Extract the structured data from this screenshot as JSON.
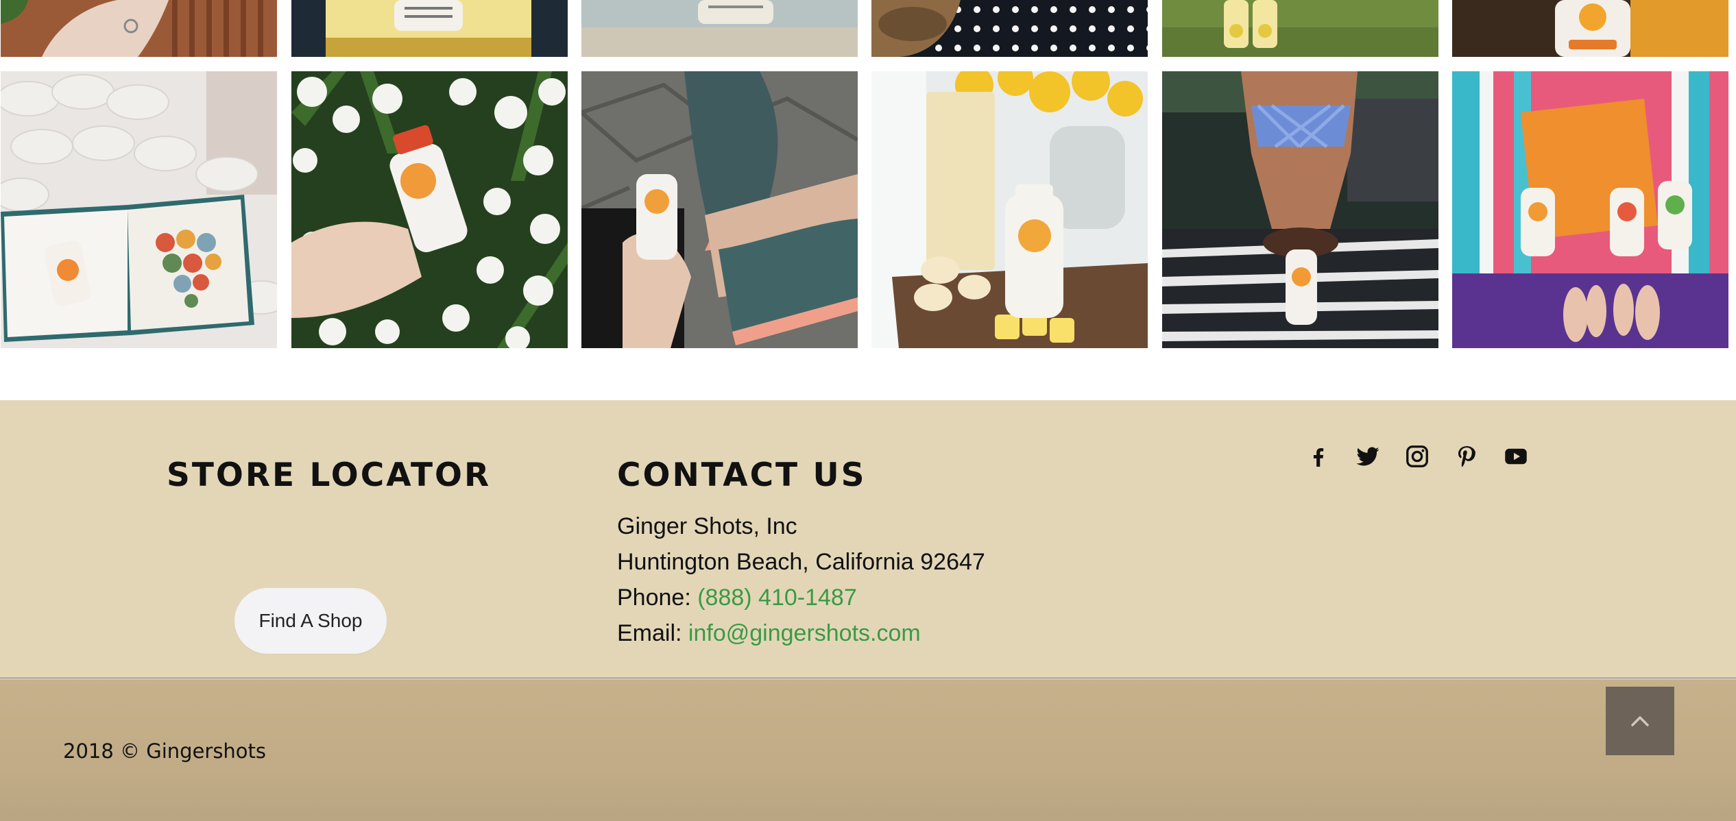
{
  "store_locator": {
    "heading": "STORE LOCATOR",
    "button_label": "Find A Shop"
  },
  "contact": {
    "heading": "CONTACT US",
    "company": "Ginger Shots, Inc",
    "address": "Huntington Beach, California 92647",
    "phone_label": "Phone:",
    "phone": "(888) 410-1487",
    "email_label": "Email:",
    "email": "info@gingershots.com"
  },
  "social": [
    "facebook-icon",
    "twitter-icon",
    "instagram-icon",
    "pinterest-icon",
    "youtube-icon"
  ],
  "footer": {
    "copyright": "2018 © Gingershots",
    "back_to_top_icon": "chevron-up-icon"
  },
  "gallery": {
    "top_row": [
      "hand-with-ring-photo",
      "pineapple-bottle-photo",
      "beach-bottle-photo",
      "polka-dot-shoes-photo",
      "bottles-on-grass-photo",
      "bottle-closeup-photo"
    ],
    "bottom_row": [
      "book-heart-blanket-photo",
      "bottle-hyacinth-flowers-photo",
      "sneakers-bottle-photo",
      "smoothie-banana-bottle-photo",
      "yoga-headstand-bottle-photo",
      "yoga-mat-bottles-photo"
    ]
  },
  "colors": {
    "footer_beige": "#e3d6b7",
    "footer_tan": "#c6b18b",
    "link_green": "#3a9a45",
    "back_to_top": "#6d6358"
  }
}
